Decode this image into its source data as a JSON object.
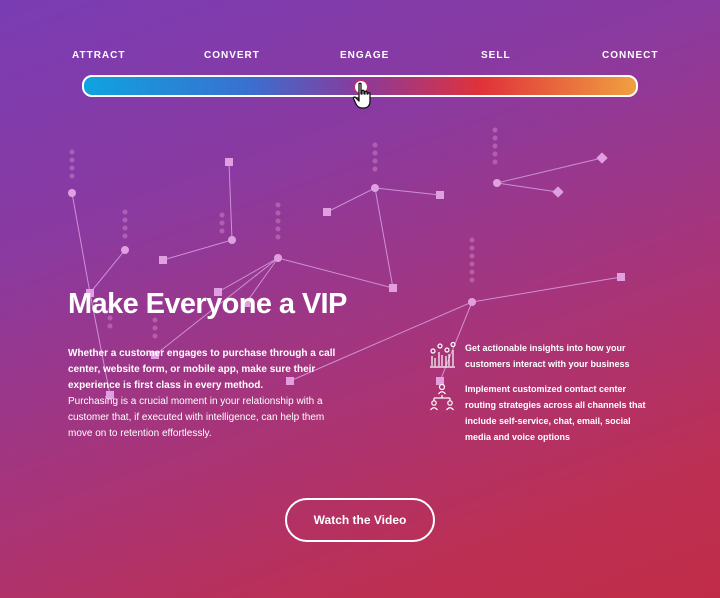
{
  "stages": {
    "labels": [
      "ATTRACT",
      "CONVERT",
      "ENGAGE",
      "SELL",
      "CONNECT"
    ],
    "active": "ENGAGE"
  },
  "hero": {
    "title": "Make Everyone a VIP",
    "lead": "Whether a customer engages to purchase through a call center, website form, or mobile app, make sure their experience is first class in every method.",
    "body": "Purchasing is a crucial moment in your relationship with a customer that, if executed with intelligence, can help them move on to retention effortlessly."
  },
  "features": [
    {
      "icon": "analytics-chart-icon",
      "text": "Get actionable insights into how your customers interact with your business"
    },
    {
      "icon": "routing-network-icon",
      "text": "Implement customized contact center routing strategies across all channels that include self-service, chat, email, social media and voice options"
    }
  ],
  "cta": {
    "label": "Watch the Video"
  },
  "colors": {
    "background_start": "#7a3cb4",
    "background_end": "#c02c48",
    "slider_start": "#0fa3e0",
    "slider_end": "#f0a040"
  }
}
